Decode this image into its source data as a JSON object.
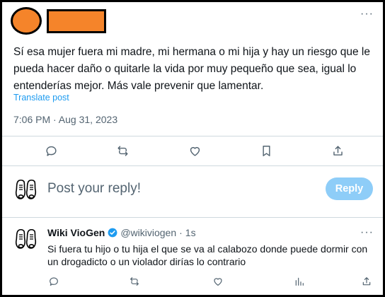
{
  "tweet": {
    "text": "Sí esa mujer fuera mi madre, mi hermana o mi hija y hay un riesgo que le pueda hacer daño o quitarle la vida por muy pequeño que sea, igual lo entenderías mejor. Más vale prevenir que lamentar.",
    "translate_label": "Translate post",
    "timestamp": "7:06 PM · Aug 31, 2023",
    "more_label": "···"
  },
  "composer": {
    "placeholder": "Post your reply!",
    "reply_button": "Reply"
  },
  "reply": {
    "name": "Wiki VioGen",
    "handle": "@wikiviogen",
    "separator": "·",
    "age": "1s",
    "text": "Si fuera tu hijo o tu hija el que se va al calabozo donde puede dormir con un drogadicto o un violador dirías lo contrario",
    "more_label": "···"
  },
  "icons": {
    "comment": "comment-icon",
    "repost": "repost-icon",
    "like": "like-icon",
    "bookmark": "bookmark-icon",
    "share": "share-icon",
    "views": "views-icon",
    "avatar": "shoes-avatar-icon",
    "verified": "verified-badge-icon"
  },
  "colors": {
    "redaction": "#f5842a",
    "accent": "#1d9bf0",
    "reply_button_disabled": "#8ecdf8",
    "muted_text": "#536471"
  }
}
